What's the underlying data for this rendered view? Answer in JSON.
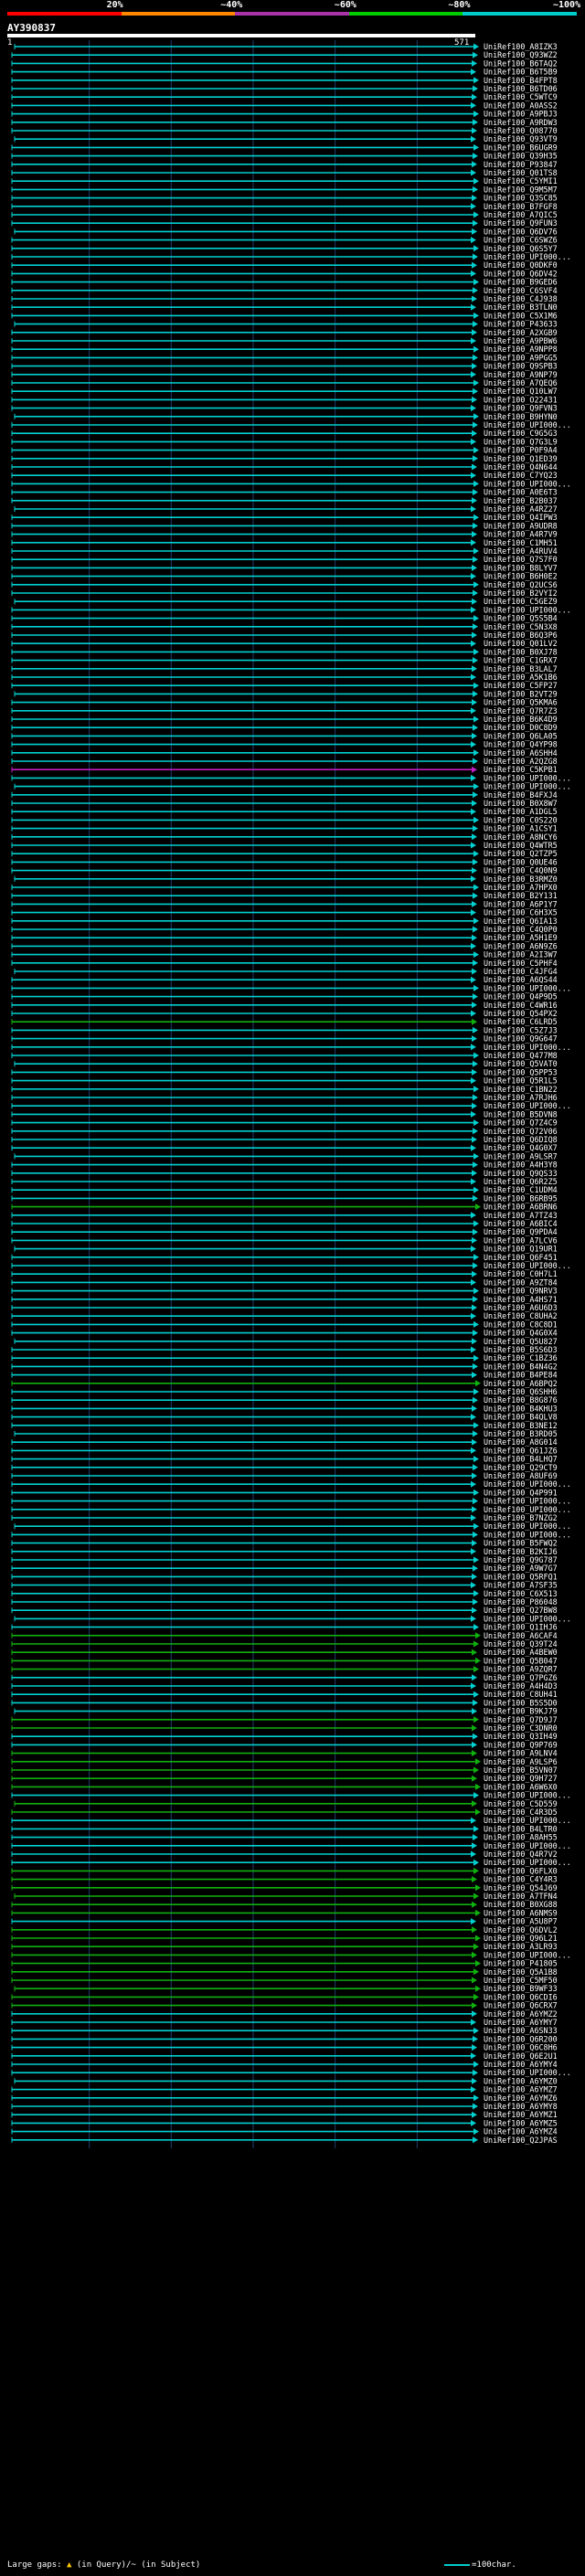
{
  "colors": {
    "bg": "#000000",
    "cyan": "#00d0d0",
    "green": "#10b010",
    "magenta": "#c020c0",
    "grid": "#1c3f6f",
    "text": "#ffffff"
  },
  "colorbar": {
    "segments": [
      "#ff0000",
      "#ff8800",
      "#aa33aa",
      "#00cc00",
      "#00cccc"
    ],
    "labels": [
      "20%",
      "~40%",
      "~60%",
      "~80%",
      "~100%"
    ]
  },
  "query": {
    "name": "AY390837",
    "start": "1",
    "end": "571"
  },
  "legend": {
    "prefix": "Large gaps: ",
    "mark_query": "▲",
    "query_text": " (in Query)/",
    "mark_subject": "~",
    "subject_text": " (in Subject)",
    "scale_text": "=100char."
  },
  "hits": [
    {
      "n": "UniRef100_A8IZK3",
      "c": "c"
    },
    {
      "n": "UniRef100_Q93WZ2",
      "c": "c"
    },
    {
      "n": "UniRef100_B6TAQ2",
      "c": "c"
    },
    {
      "n": "UniRef100_B6T5B9",
      "c": "c"
    },
    {
      "n": "UniRef100_B4FPT8",
      "c": "c"
    },
    {
      "n": "UniRef100_B6TD06",
      "c": "c"
    },
    {
      "n": "UniRef100_C5WTC9",
      "c": "c"
    },
    {
      "n": "UniRef100_A0ASS2",
      "c": "c"
    },
    {
      "n": "UniRef100_A9PBJ3",
      "c": "c"
    },
    {
      "n": "UniRef100_A9RDW3",
      "c": "c"
    },
    {
      "n": "UniRef100_Q08770",
      "c": "c"
    },
    {
      "n": "UniRef100_Q93VT9",
      "c": "c"
    },
    {
      "n": "UniRef100_B6UGR9",
      "c": "c"
    },
    {
      "n": "UniRef100_Q39H35",
      "c": "c"
    },
    {
      "n": "UniRef100_P93847",
      "c": "c"
    },
    {
      "n": "UniRef100_Q01TS8",
      "c": "c"
    },
    {
      "n": "UniRef100_C5YMI1",
      "c": "c"
    },
    {
      "n": "UniRef100_Q9M5M7",
      "c": "c"
    },
    {
      "n": "UniRef100_Q3SC85",
      "c": "c"
    },
    {
      "n": "UniRef100_B7FGF8",
      "c": "c"
    },
    {
      "n": "UniRef100_A7QIC5",
      "c": "c"
    },
    {
      "n": "UniRef100_Q9FUN3",
      "c": "c"
    },
    {
      "n": "UniRef100_Q6DV76",
      "c": "c"
    },
    {
      "n": "UniRef100_C6SWZ6",
      "c": "c"
    },
    {
      "n": "UniRef100_Q6S5Y7",
      "c": "c"
    },
    {
      "n": "UniRef100_UPI000...",
      "c": "c"
    },
    {
      "n": "UniRef100_Q0DKF0",
      "c": "c"
    },
    {
      "n": "UniRef100_Q6DV42",
      "c": "c"
    },
    {
      "n": "UniRef100_B9GED6",
      "c": "c"
    },
    {
      "n": "UniRef100_C6SVF4",
      "c": "c"
    },
    {
      "n": "UniRef100_C4J938",
      "c": "c"
    },
    {
      "n": "UniRef100_B3TLN0",
      "c": "c"
    },
    {
      "n": "UniRef100_C5X1M6",
      "c": "c"
    },
    {
      "n": "UniRef100_P43633",
      "c": "c"
    },
    {
      "n": "UniRef100_A2XGB9",
      "c": "c"
    },
    {
      "n": "UniRef100_A9PBW6",
      "c": "c"
    },
    {
      "n": "UniRef100_A9NPP8",
      "c": "c"
    },
    {
      "n": "UniRef100_A9PGG5",
      "c": "c"
    },
    {
      "n": "UniRef100_Q9SPB3",
      "c": "c"
    },
    {
      "n": "UniRef100_A9NP79",
      "c": "c"
    },
    {
      "n": "UniRef100_A7QEQ6",
      "c": "c"
    },
    {
      "n": "UniRef100_Q10LW7",
      "c": "c"
    },
    {
      "n": "UniRef100_O22431",
      "c": "c"
    },
    {
      "n": "UniRef100_Q9FVN3",
      "c": "c"
    },
    {
      "n": "UniRef100_B9HYN0",
      "c": "c"
    },
    {
      "n": "UniRef100_UPI000...",
      "c": "c"
    },
    {
      "n": "UniRef100_C9G5G3",
      "c": "c"
    },
    {
      "n": "UniRef100_Q7G3L9",
      "c": "c"
    },
    {
      "n": "UniRef100_P0F9A4",
      "c": "c"
    },
    {
      "n": "UniRef100_Q1ED39",
      "c": "c"
    },
    {
      "n": "UniRef100_Q4N644",
      "c": "c"
    },
    {
      "n": "UniRef100_C7YQ23",
      "c": "c"
    },
    {
      "n": "UniRef100_UPI000...",
      "c": "c"
    },
    {
      "n": "UniRef100_A0E6T3",
      "c": "c"
    },
    {
      "n": "UniRef100_B2B037",
      "c": "c"
    },
    {
      "n": "UniRef100_A4RZ27",
      "c": "c"
    },
    {
      "n": "UniRef100_Q4IPW3",
      "c": "c"
    },
    {
      "n": "UniRef100_A9UDR8",
      "c": "c"
    },
    {
      "n": "UniRef100_A4R7V9",
      "c": "c"
    },
    {
      "n": "UniRef100_C1MH51",
      "c": "c"
    },
    {
      "n": "UniRef100_A4RUV4",
      "c": "c"
    },
    {
      "n": "UniRef100_Q7S7F0",
      "c": "c"
    },
    {
      "n": "UniRef100_B8LYV7",
      "c": "c"
    },
    {
      "n": "UniRef100_B6H0E2",
      "c": "c"
    },
    {
      "n": "UniRef100_Q2UCS6",
      "c": "c"
    },
    {
      "n": "UniRef100_B2VYI2",
      "c": "c"
    },
    {
      "n": "UniRef100_C5GEZ9",
      "c": "c"
    },
    {
      "n": "UniRef100_UPI000...",
      "c": "c"
    },
    {
      "n": "UniRef100_Q5S5B4",
      "c": "c"
    },
    {
      "n": "UniRef100_C5N3X8",
      "c": "c"
    },
    {
      "n": "UniRef100_B6Q3P6",
      "c": "c"
    },
    {
      "n": "UniRef100_Q01LV2",
      "c": "c"
    },
    {
      "n": "UniRef100_B0XJ78",
      "c": "c"
    },
    {
      "n": "UniRef100_C1GRX7",
      "c": "c"
    },
    {
      "n": "UniRef100_B3LAL7",
      "c": "c"
    },
    {
      "n": "UniRef100_A5K1B6",
      "c": "c"
    },
    {
      "n": "UniRef100_C5FP27",
      "c": "c"
    },
    {
      "n": "UniRef100_B2VT29",
      "c": "c"
    },
    {
      "n": "UniRef100_Q5KMA6",
      "c": "c"
    },
    {
      "n": "UniRef100_Q7R7Z3",
      "c": "c"
    },
    {
      "n": "UniRef100_B6K4D9",
      "c": "c"
    },
    {
      "n": "UniRef100_D0C8D9",
      "c": "c"
    },
    {
      "n": "UniRef100_Q6LA05",
      "c": "c"
    },
    {
      "n": "UniRef100_Q4YP98",
      "c": "c"
    },
    {
      "n": "UniRef100_A6SHH4",
      "c": "c"
    },
    {
      "n": "UniRef100_A2QZG8",
      "c": "c"
    },
    {
      "n": "UniRef100_C5KPB1",
      "c": "m"
    },
    {
      "n": "UniRef100_UPI000...",
      "c": "c"
    },
    {
      "n": "UniRef100_UPI000...",
      "c": "c"
    },
    {
      "n": "UniRef100_B4FXJ4",
      "c": "c"
    },
    {
      "n": "UniRef100_B0X8W7",
      "c": "c"
    },
    {
      "n": "UniRef100_A1DGL5",
      "c": "c"
    },
    {
      "n": "UniRef100_C0S220",
      "c": "c"
    },
    {
      "n": "UniRef100_A1CSY1",
      "c": "c"
    },
    {
      "n": "UniRef100_A8NCY6",
      "c": "c"
    },
    {
      "n": "UniRef100_Q4WTR5",
      "c": "c"
    },
    {
      "n": "UniRef100_Q2TZP5",
      "c": "c"
    },
    {
      "n": "UniRef100_Q0UE46",
      "c": "c"
    },
    {
      "n": "UniRef100_C4Q0N9",
      "c": "c"
    },
    {
      "n": "UniRef100_B3RMZ0",
      "c": "c"
    },
    {
      "n": "UniRef100_A7HPX0",
      "c": "c"
    },
    {
      "n": "UniRef100_B2Y131",
      "c": "c"
    },
    {
      "n": "UniRef100_A6P1Y7",
      "c": "c"
    },
    {
      "n": "UniRef100_C6H3X5",
      "c": "c"
    },
    {
      "n": "UniRef100_Q6IA13",
      "c": "c"
    },
    {
      "n": "UniRef100_C4Q0P0",
      "c": "c"
    },
    {
      "n": "UniRef100_A5H1E9",
      "c": "c"
    },
    {
      "n": "UniRef100_A6N9Z6",
      "c": "c"
    },
    {
      "n": "UniRef100_A2I3W7",
      "c": "c"
    },
    {
      "n": "UniRef100_C5PHF4",
      "c": "c"
    },
    {
      "n": "UniRef100_C4JFG4",
      "c": "c"
    },
    {
      "n": "UniRef100_A6QS44",
      "c": "c"
    },
    {
      "n": "UniRef100_UPI000...",
      "c": "c"
    },
    {
      "n": "UniRef100_Q4P9D5",
      "c": "c"
    },
    {
      "n": "UniRef100_C4WR16",
      "c": "c"
    },
    {
      "n": "UniRef100_Q54PX2",
      "c": "c"
    },
    {
      "n": "UniRef100_C6LRD5",
      "c": "g"
    },
    {
      "n": "UniRef100_C5Z7J3",
      "c": "c"
    },
    {
      "n": "UniRef100_Q9G647",
      "c": "c"
    },
    {
      "n": "UniRef100_UPI000...",
      "c": "c"
    },
    {
      "n": "UniRef100_Q477M8",
      "c": "c"
    },
    {
      "n": "UniRef100_Q5VAT0",
      "c": "c"
    },
    {
      "n": "UniRef100_Q5PP53",
      "c": "c"
    },
    {
      "n": "UniRef100_Q5R1L5",
      "c": "c"
    },
    {
      "n": "UniRef100_C1BN22",
      "c": "c"
    },
    {
      "n": "UniRef100_A7RJH6",
      "c": "c"
    },
    {
      "n": "UniRef100_UPI000...",
      "c": "c"
    },
    {
      "n": "UniRef100_B5DVN8",
      "c": "c"
    },
    {
      "n": "UniRef100_Q7Z4C9",
      "c": "c"
    },
    {
      "n": "UniRef100_Q72V06",
      "c": "c"
    },
    {
      "n": "UniRef100_Q6DIQ8",
      "c": "c"
    },
    {
      "n": "UniRef100_Q4G0X7",
      "c": "c"
    },
    {
      "n": "UniRef100_A9LSR7",
      "c": "c"
    },
    {
      "n": "UniRef100_A4H3Y8",
      "c": "c"
    },
    {
      "n": "UniRef100_Q9QS33",
      "c": "c"
    },
    {
      "n": "UniRef100_Q6R2Z5",
      "c": "c"
    },
    {
      "n": "UniRef100_C1UDM4",
      "c": "c"
    },
    {
      "n": "UniRef100_B6RB95",
      "c": "c"
    },
    {
      "n": "UniRef100_A6BRN6",
      "c": "g"
    },
    {
      "n": "UniRef100_A7TZ43",
      "c": "c"
    },
    {
      "n": "UniRef100_A6BIC4",
      "c": "c"
    },
    {
      "n": "UniRef100_Q9PDA4",
      "c": "c"
    },
    {
      "n": "UniRef100_A7LCV6",
      "c": "c"
    },
    {
      "n": "UniRef100_Q19UR1",
      "c": "c"
    },
    {
      "n": "UniRef100_Q6F451",
      "c": "c"
    },
    {
      "n": "UniRef100_UPI000...",
      "c": "c"
    },
    {
      "n": "UniRef100_C0H7L1",
      "c": "c"
    },
    {
      "n": "UniRef100_A9ZT84",
      "c": "c"
    },
    {
      "n": "UniRef100_Q9NRV3",
      "c": "c"
    },
    {
      "n": "UniRef100_A4HS71",
      "c": "c"
    },
    {
      "n": "UniRef100_A6U6D3",
      "c": "c"
    },
    {
      "n": "UniRef100_C8UHA2",
      "c": "c"
    },
    {
      "n": "UniRef100_C8C8D1",
      "c": "c"
    },
    {
      "n": "UniRef100_Q4G0X4",
      "c": "c"
    },
    {
      "n": "UniRef100_Q5U827",
      "c": "c"
    },
    {
      "n": "UniRef100_B5S6D3",
      "c": "c"
    },
    {
      "n": "UniRef100_C1BZ36",
      "c": "c"
    },
    {
      "n": "UniRef100_B4N4G2",
      "c": "c"
    },
    {
      "n": "UniRef100_B4PE84",
      "c": "c"
    },
    {
      "n": "UniRef100_A6BPQ2",
      "c": "g"
    },
    {
      "n": "UniRef100_Q6SHH6",
      "c": "c"
    },
    {
      "n": "UniRef100_B8G876",
      "c": "c"
    },
    {
      "n": "UniRef100_B4KHU3",
      "c": "c"
    },
    {
      "n": "UniRef100_B4QLV8",
      "c": "c"
    },
    {
      "n": "UniRef100_B3NE12",
      "c": "c"
    },
    {
      "n": "UniRef100_B3RD05",
      "c": "c"
    },
    {
      "n": "UniRef100_A8G014",
      "c": "c"
    },
    {
      "n": "UniRef100_Q61JZ6",
      "c": "c"
    },
    {
      "n": "UniRef100_B4LHQ7",
      "c": "c"
    },
    {
      "n": "UniRef100_Q29CT9",
      "c": "c"
    },
    {
      "n": "UniRef100_A8UF69",
      "c": "c"
    },
    {
      "n": "UniRef100_UPI000...",
      "c": "c"
    },
    {
      "n": "UniRef100_Q4P991",
      "c": "c"
    },
    {
      "n": "UniRef100_UPI000...",
      "c": "c"
    },
    {
      "n": "UniRef100_UPI000...",
      "c": "c"
    },
    {
      "n": "UniRef100_B7NZG2",
      "c": "c"
    },
    {
      "n": "UniRef100_UPI000...",
      "c": "c"
    },
    {
      "n": "UniRef100_UPI000...",
      "c": "c"
    },
    {
      "n": "UniRef100_B5FWQ2",
      "c": "c"
    },
    {
      "n": "UniRef100_B2KIJ6",
      "c": "c"
    },
    {
      "n": "UniRef100_Q9G787",
      "c": "c"
    },
    {
      "n": "UniRef100_A9W7G7",
      "c": "c"
    },
    {
      "n": "UniRef100_Q5RFQ1",
      "c": "c"
    },
    {
      "n": "UniRef100_A7SF35",
      "c": "c"
    },
    {
      "n": "UniRef100_C6X513",
      "c": "c"
    },
    {
      "n": "UniRef100_P86048",
      "c": "c"
    },
    {
      "n": "UniRef100_Q27BW8",
      "c": "c"
    },
    {
      "n": "UniRef100_UPI000...",
      "c": "c"
    },
    {
      "n": "UniRef100_Q1IHJ6",
      "c": "c"
    },
    {
      "n": "UniRef100_A6CAF4",
      "c": "g"
    },
    {
      "n": "UniRef100_Q39T24",
      "c": "g"
    },
    {
      "n": "UniRef100_A4BEW0",
      "c": "g"
    },
    {
      "n": "UniRef100_Q5B047",
      "c": "g"
    },
    {
      "n": "UniRef100_A9ZQR7",
      "c": "g"
    },
    {
      "n": "UniRef100_Q7PGZ6",
      "c": "c"
    },
    {
      "n": "UniRef100_A4H4D3",
      "c": "c"
    },
    {
      "n": "UniRef100_C8UH41",
      "c": "c"
    },
    {
      "n": "UniRef100_B5S5D0",
      "c": "c"
    },
    {
      "n": "UniRef100_B9KJ79",
      "c": "c"
    },
    {
      "n": "UniRef100_Q7D9J7",
      "c": "g"
    },
    {
      "n": "UniRef100_C3DNR0",
      "c": "g"
    },
    {
      "n": "UniRef100_Q3IH49",
      "c": "c"
    },
    {
      "n": "UniRef100_Q9P769",
      "c": "c"
    },
    {
      "n": "UniRef100_A9LNV4",
      "c": "g"
    },
    {
      "n": "UniRef100_A9LSP6",
      "c": "g"
    },
    {
      "n": "UniRef100_B5VN07",
      "c": "g"
    },
    {
      "n": "UniRef100_Q9H727",
      "c": "g"
    },
    {
      "n": "UniRef100_A6W6X0",
      "c": "g"
    },
    {
      "n": "UniRef100_UPI000...",
      "c": "c"
    },
    {
      "n": "UniRef100_C5D559",
      "c": "g"
    },
    {
      "n": "UniRef100_C4R3D5",
      "c": "g"
    },
    {
      "n": "UniRef100_UPI000...",
      "c": "c"
    },
    {
      "n": "UniRef100_B4LTR0",
      "c": "c"
    },
    {
      "n": "UniRef100_A8AH55",
      "c": "c"
    },
    {
      "n": "UniRef100_UPI000...",
      "c": "c"
    },
    {
      "n": "UniRef100_Q4R7V2",
      "c": "c"
    },
    {
      "n": "UniRef100_UPI000...",
      "c": "c"
    },
    {
      "n": "UniRef100_Q6FLX0",
      "c": "g"
    },
    {
      "n": "UniRef100_C4Y4R3",
      "c": "g"
    },
    {
      "n": "UniRef100_Q54J69",
      "c": "g"
    },
    {
      "n": "UniRef100_A7TFN4",
      "c": "g"
    },
    {
      "n": "UniRef100_B0XG88",
      "c": "g"
    },
    {
      "n": "UniRef100_A6NMS9",
      "c": "g"
    },
    {
      "n": "UniRef100_A5U8P7",
      "c": "c"
    },
    {
      "n": "UniRef100_Q6DVL2",
      "c": "g"
    },
    {
      "n": "UniRef100_Q96L21",
      "c": "g"
    },
    {
      "n": "UniRef100_A3LR93",
      "c": "g"
    },
    {
      "n": "UniRef100_UPI000...",
      "c": "g"
    },
    {
      "n": "UniRef100_P41805",
      "c": "g"
    },
    {
      "n": "UniRef100_Q5A1B8",
      "c": "g"
    },
    {
      "n": "UniRef100_C5MF50",
      "c": "g"
    },
    {
      "n": "UniRef100_B9WF33",
      "c": "g"
    },
    {
      "n": "UniRef100_Q6CDI6",
      "c": "g"
    },
    {
      "n": "UniRef100_Q6CRX7",
      "c": "g"
    },
    {
      "n": "UniRef100_A6YMZ2",
      "c": "c"
    },
    {
      "n": "UniRef100_A6YMY7",
      "c": "c"
    },
    {
      "n": "UniRef100_A6SN33",
      "c": "c"
    },
    {
      "n": "UniRef100_Q6R200",
      "c": "c"
    },
    {
      "n": "UniRef100_Q6C8H6",
      "c": "c"
    },
    {
      "n": "UniRef100_Q6E2U1",
      "c": "c"
    },
    {
      "n": "UniRef100_A6YMY4",
      "c": "c"
    },
    {
      "n": "UniRef100_UPI000...",
      "c": "c"
    },
    {
      "n": "UniRef100_A6YMZ0",
      "c": "c"
    },
    {
      "n": "UniRef100_A6YMZ7",
      "c": "c"
    },
    {
      "n": "UniRef100_A6YMZ6",
      "c": "c"
    },
    {
      "n": "UniRef100_A6YMY8",
      "c": "c"
    },
    {
      "n": "UniRef100_A6YMZ1",
      "c": "c"
    },
    {
      "n": "UniRef100_A6YMZ5",
      "c": "c"
    },
    {
      "n": "UniRef100_A6YMZ4",
      "c": "c"
    },
    {
      "n": "UniRef100_Q2JPAS",
      "c": "c"
    }
  ]
}
